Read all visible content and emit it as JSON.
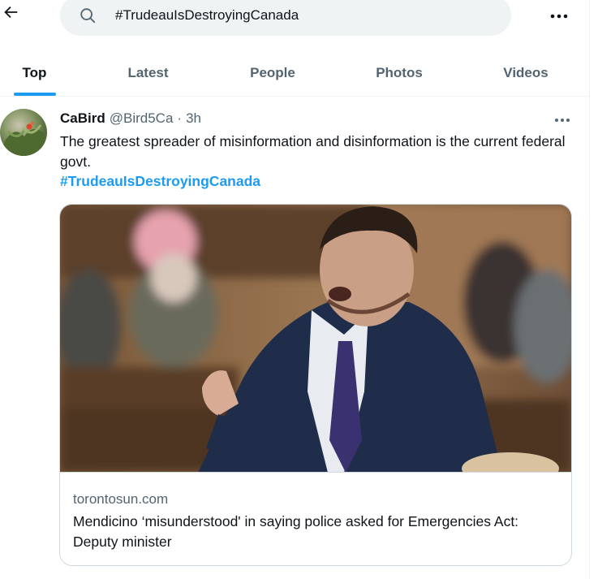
{
  "header": {
    "search_value": "#TrudeauIsDestroyingCanada"
  },
  "tabs": [
    {
      "label": "Top",
      "active": true
    },
    {
      "label": "Latest",
      "active": false
    },
    {
      "label": "People",
      "active": false
    },
    {
      "label": "Photos",
      "active": false
    },
    {
      "label": "Videos",
      "active": false
    }
  ],
  "tweet": {
    "display_name": "CaBird",
    "handle": "@Bird5Ca",
    "separator": "·",
    "time": "3h",
    "text": "The greatest spreader of misinformation and disinformation is the current federal govt.",
    "hashtag": "#TrudeauIsDestroyingCanada",
    "card": {
      "domain": "torontosun.com",
      "title": "Mendicino ‘misunderstood' in saying police asked for Emergencies Act: Deputy minister"
    }
  },
  "icons": {
    "back": "arrow-left-icon",
    "search": "search-icon",
    "more": "more-horizontal-icon"
  },
  "colors": {
    "accent": "#1d9bf0",
    "text_primary": "#0f1419",
    "text_secondary": "#536471",
    "search_bg": "#eff3f4",
    "border": "#cfd9de"
  }
}
